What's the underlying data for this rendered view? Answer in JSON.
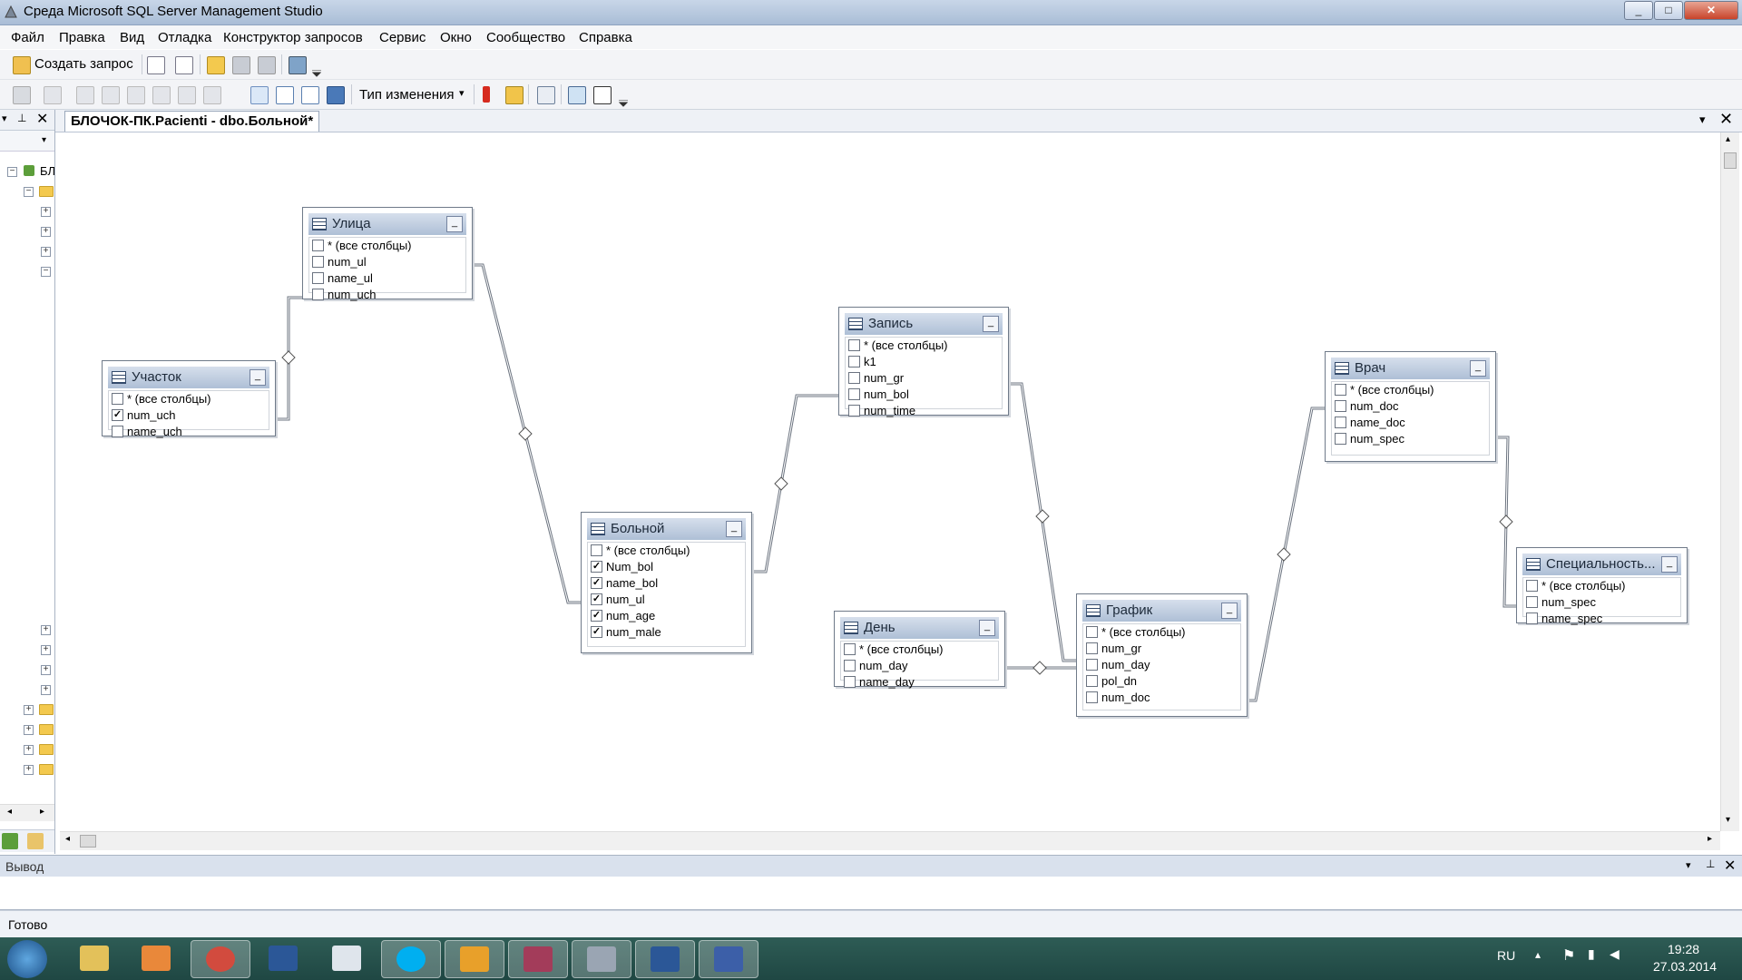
{
  "window": {
    "title": "Среда Microsoft SQL Server Management Studio",
    "min": "_",
    "max": "□",
    "close": "✕"
  },
  "menu": [
    "Файл",
    "Правка",
    "Вид",
    "Отладка",
    "Конструктор запросов",
    "Сервис",
    "Окно",
    "Сообщество",
    "Справка"
  ],
  "toolbar": {
    "new_query": "Создать запрос",
    "change_type": "Тип изменения",
    "change_type_arrow": "▾"
  },
  "document_tab": {
    "label": "БЛОЧОК-ПК.Pacienti - dbo.Больной*"
  },
  "explorer": {
    "root_label": "БЛ"
  },
  "tables": [
    {
      "name": "Улица",
      "columns": [
        {
          "name": "* (все столбцы)",
          "checked": false
        },
        {
          "name": "num_ul",
          "checked": false
        },
        {
          "name": "name_ul",
          "checked": false
        },
        {
          "name": "num_uch",
          "checked": false
        }
      ]
    },
    {
      "name": "Участок",
      "columns": [
        {
          "name": "* (все столбцы)",
          "checked": false
        },
        {
          "name": "num_uch",
          "checked": true
        },
        {
          "name": "name_uch",
          "checked": false
        }
      ]
    },
    {
      "name": "Больной",
      "columns": [
        {
          "name": "* (все столбцы)",
          "checked": false
        },
        {
          "name": "Num_bol",
          "checked": true
        },
        {
          "name": "name_bol",
          "checked": true
        },
        {
          "name": "num_ul",
          "checked": true
        },
        {
          "name": "num_age",
          "checked": true
        },
        {
          "name": "num_male",
          "checked": true
        }
      ]
    },
    {
      "name": "Запись",
      "columns": [
        {
          "name": "* (все столбцы)",
          "checked": false
        },
        {
          "name": "k1",
          "checked": false
        },
        {
          "name": "num_gr",
          "checked": false
        },
        {
          "name": "num_bol",
          "checked": false
        },
        {
          "name": "num_time",
          "checked": false
        }
      ]
    },
    {
      "name": "День",
      "columns": [
        {
          "name": "* (все столбцы)",
          "checked": false
        },
        {
          "name": "num_day",
          "checked": false
        },
        {
          "name": "name_day",
          "checked": false
        }
      ]
    },
    {
      "name": "График",
      "columns": [
        {
          "name": "* (все столбцы)",
          "checked": false
        },
        {
          "name": "num_gr",
          "checked": false
        },
        {
          "name": "num_day",
          "checked": false
        },
        {
          "name": "pol_dn",
          "checked": false
        },
        {
          "name": "num_doc",
          "checked": false
        }
      ]
    },
    {
      "name": "Врач",
      "columns": [
        {
          "name": "* (все столбцы)",
          "checked": false
        },
        {
          "name": "num_doc",
          "checked": false
        },
        {
          "name": "name_doc",
          "checked": false
        },
        {
          "name": "num_spec",
          "checked": false
        }
      ]
    },
    {
      "name": "Специальность...",
      "columns": [
        {
          "name": "* (все столбцы)",
          "checked": false
        },
        {
          "name": "num_spec",
          "checked": false
        },
        {
          "name": "name_spec",
          "checked": false
        }
      ]
    }
  ],
  "output": {
    "title": "Вывод"
  },
  "status": {
    "text": "Готово"
  },
  "tray": {
    "lang": "RU",
    "time": "19:28",
    "date": "27.03.2014"
  },
  "colors": {
    "title_bar": "#a9bdd6",
    "table_header": "#aebfd6",
    "taskbar": "#1f4743"
  }
}
